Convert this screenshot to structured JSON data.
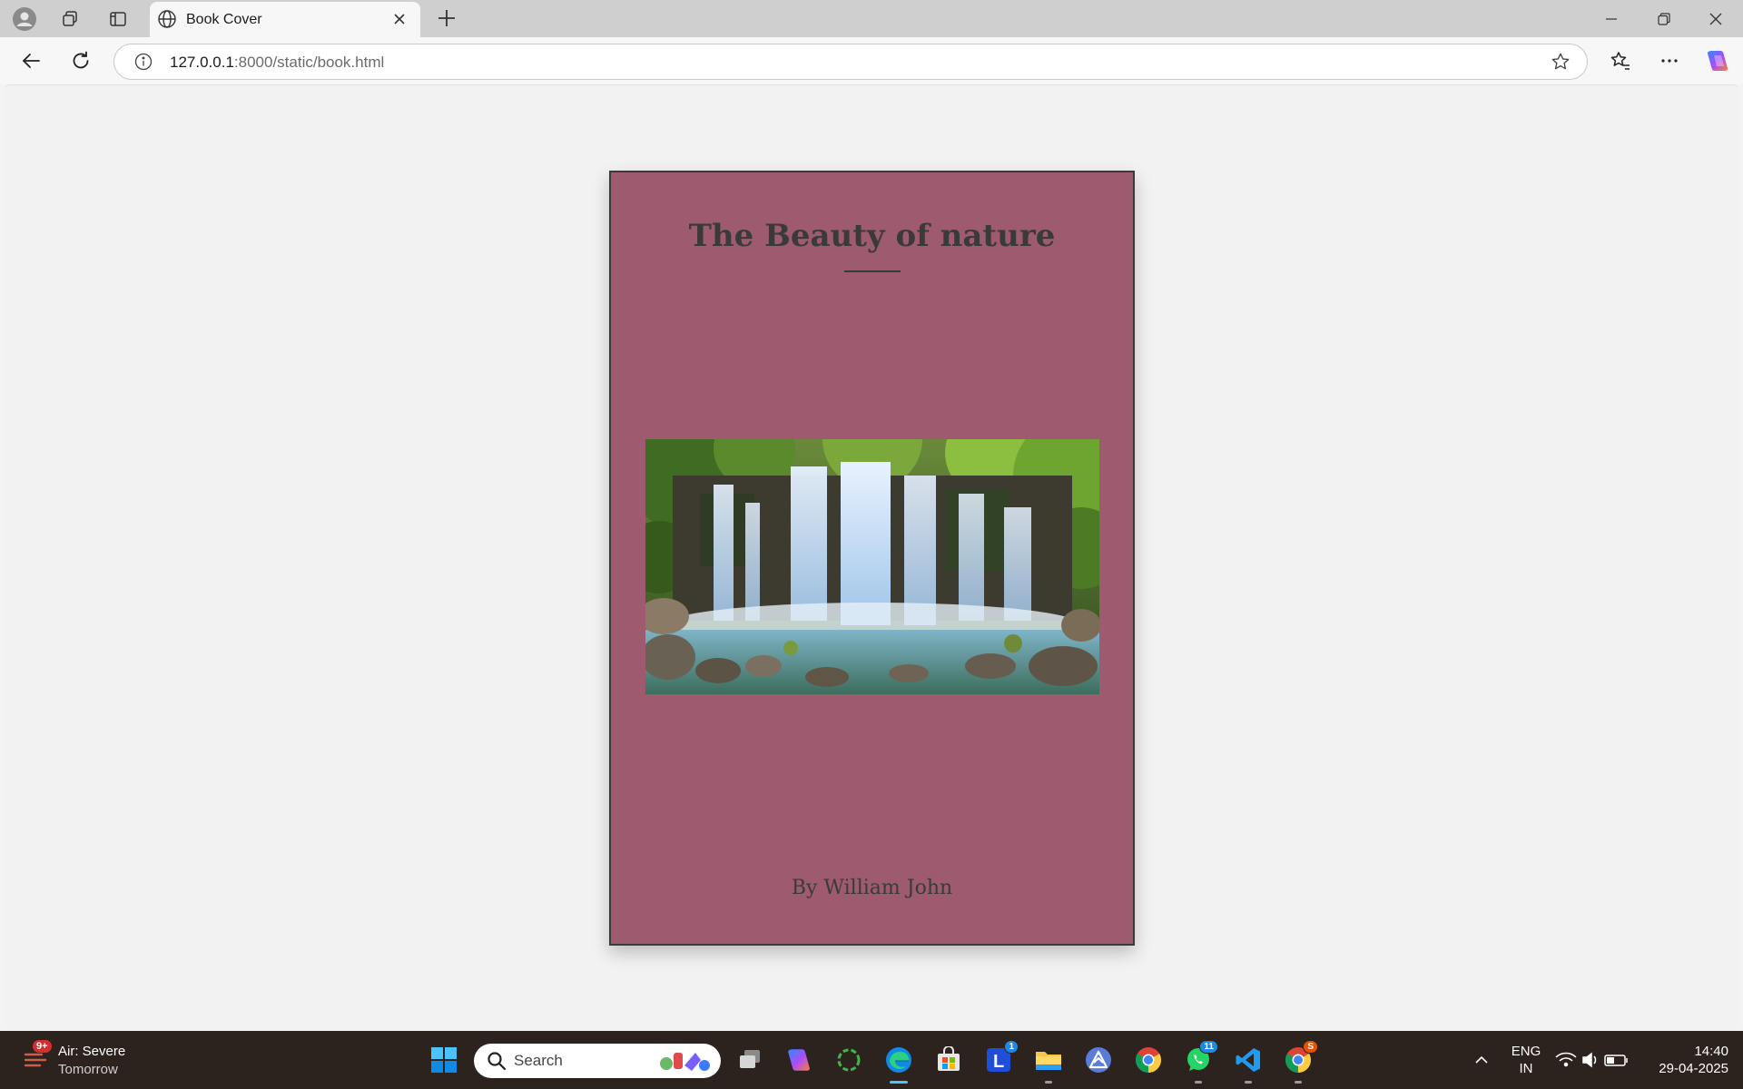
{
  "browser": {
    "tab": {
      "title": "Book Cover"
    },
    "address": {
      "host": "127.0.0.1",
      "rest": ":8000/static/book.html"
    }
  },
  "book": {
    "title": "The Beauty of nature",
    "author": "By William John",
    "background_color": "#9e5b6f",
    "image_alt": "waterfall-image"
  },
  "taskbar": {
    "weather": {
      "badge": "9+",
      "condition": "Air: Severe",
      "when": "Tomorrow"
    },
    "search_label": "Search",
    "badges": {
      "outlook": "1",
      "whatsapp": "11",
      "chrome_profile": "S"
    },
    "language": {
      "line1": "ENG",
      "line2": "IN"
    },
    "clock": {
      "time": "14:40",
      "date": "29-04-2025"
    }
  }
}
